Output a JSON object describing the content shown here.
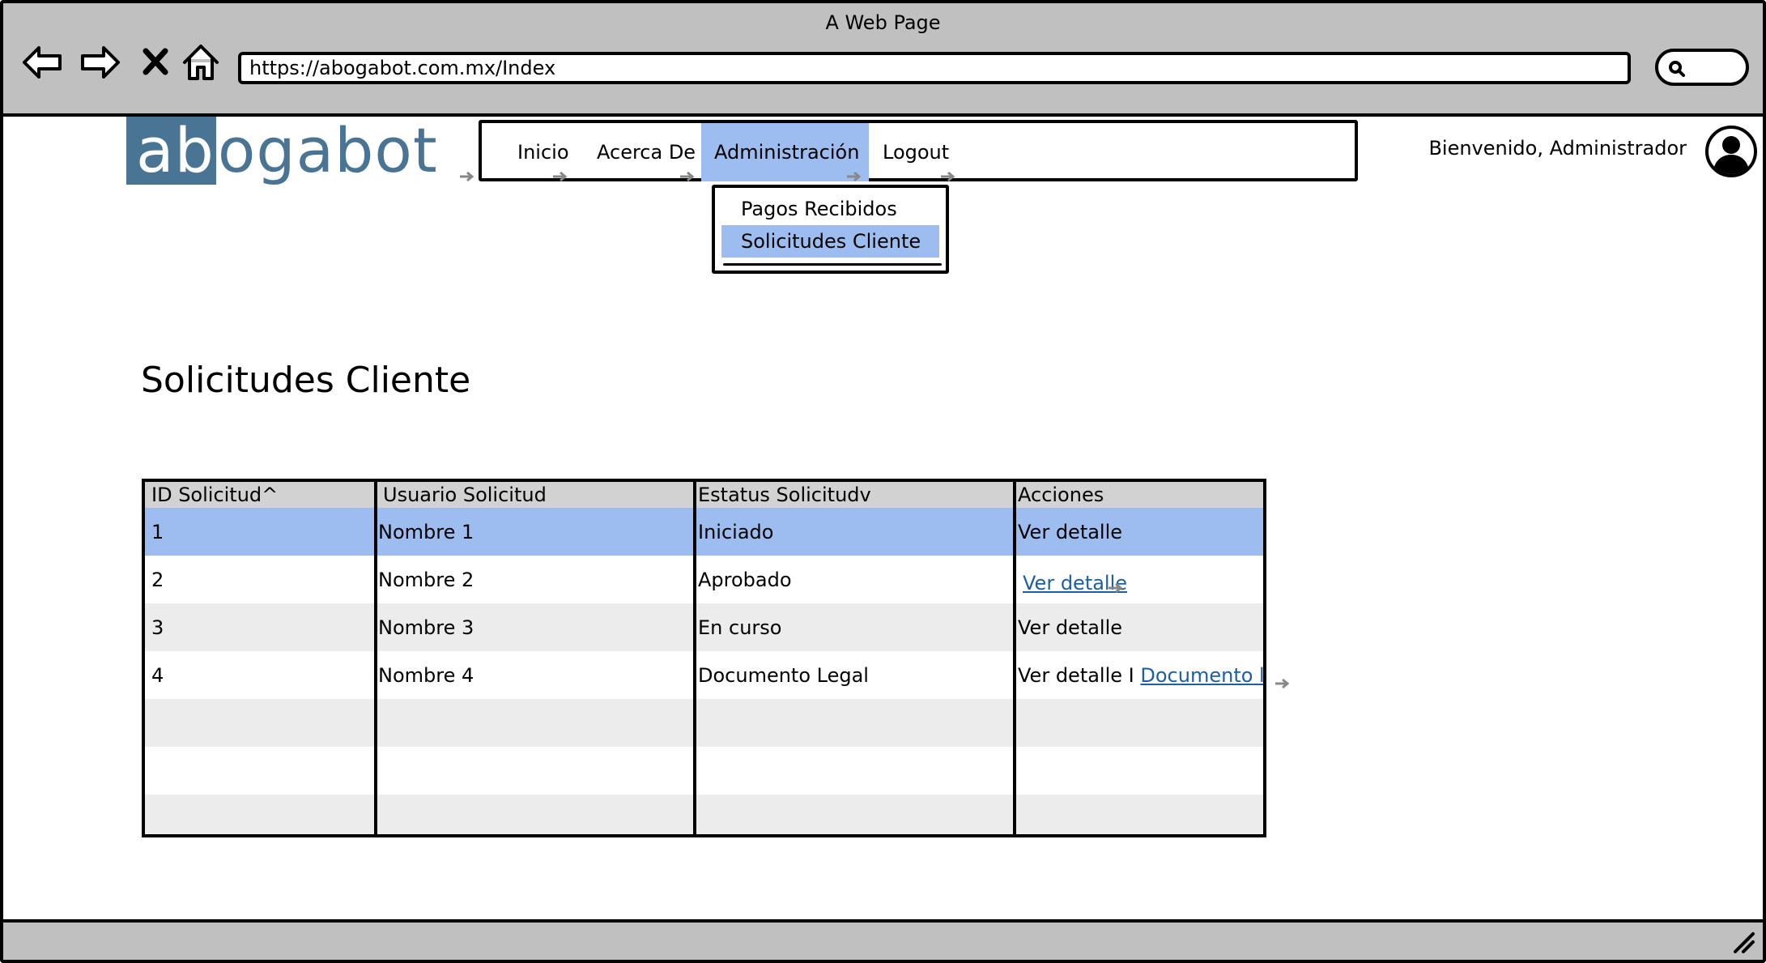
{
  "browser": {
    "window_title": "A Web Page",
    "url": "https://abogabot.com.mx/Index"
  },
  "logo": {
    "part1": "ab",
    "part2": "ogabot"
  },
  "nav": {
    "items": [
      {
        "label": "Inicio"
      },
      {
        "label": "Acerca De"
      },
      {
        "label": "Administración"
      },
      {
        "label": "Logout"
      }
    ],
    "active": "Administración"
  },
  "dropdown": {
    "items": [
      {
        "label": "Pagos Recibidos"
      },
      {
        "label": "Solicitudes Cliente"
      }
    ],
    "selected": "Solicitudes Cliente"
  },
  "user": {
    "welcome": "Bienvenido, Administrador"
  },
  "page": {
    "title": "Solicitudes Cliente"
  },
  "table": {
    "headers": [
      "ID Solicitud^",
      "Usuario Solicitud",
      "Estatus Solicitudv",
      "Acciones"
    ],
    "rows": [
      {
        "id": "1",
        "user": "Nombre 1",
        "status": "Iniciado",
        "action": "Ver detalle"
      },
      {
        "id": "2",
        "user": "Nombre 2",
        "status": "Aprobado",
        "action": "Ver detalle"
      },
      {
        "id": "3",
        "user": "Nombre 3",
        "status": "En curso",
        "action": "Ver detalle"
      },
      {
        "id": "4",
        "user": "Nombre 4",
        "status": "Documento Legal",
        "action": "Ver detalle I",
        "extra_link": "Documento legal"
      }
    ]
  },
  "colors": {
    "accent": "#9dbdf1",
    "chrome": "#c0c0c0",
    "logo": "#4a7494",
    "link": "#1d5fa0"
  }
}
